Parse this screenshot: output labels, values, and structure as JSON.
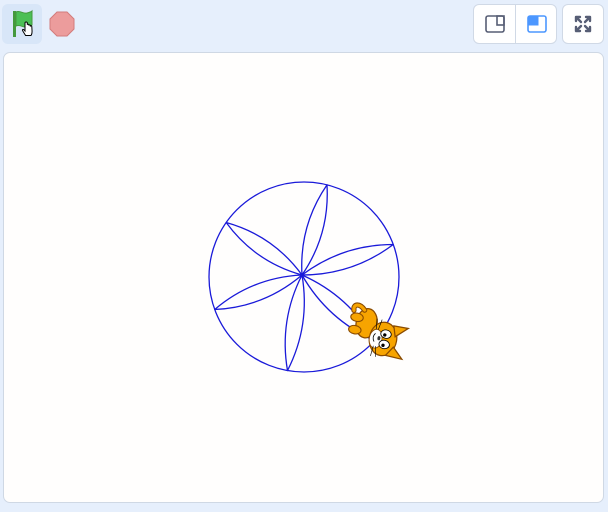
{
  "toolbar": {
    "green_flag": {
      "icon": "green-flag-icon",
      "color": "#4cbf56"
    },
    "stop": {
      "icon": "stop-sign-icon",
      "color": "#ec9c9c"
    },
    "stage_size_small": {
      "icon": "small-stage-icon"
    },
    "stage_size_large": {
      "icon": "large-stage-icon",
      "accent": "#4c97ff"
    },
    "fullscreen": {
      "icon": "fullscreen-icon"
    }
  },
  "stage": {
    "pen_color": "#1a1ad9",
    "sprite": {
      "name": "cat-sprite",
      "icon": "cat-icon",
      "color": "#f7a400"
    }
  }
}
